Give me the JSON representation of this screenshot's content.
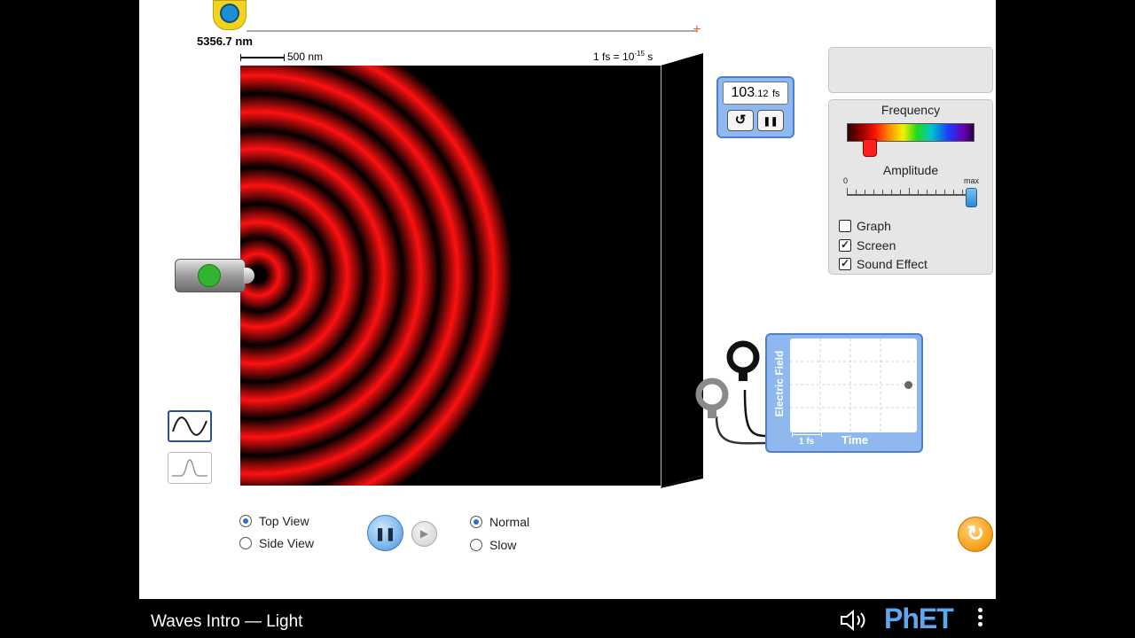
{
  "tape_measure": {
    "readout": "5356.7 nm"
  },
  "scale": {
    "length_label": "500 nm",
    "time_scale_prefix": "1 fs = 10",
    "time_scale_exponent": "-15",
    "time_scale_suffix": " s"
  },
  "stopwatch": {
    "value": "103",
    "decimals": ".12",
    "unit": "fs",
    "reset_icon": "↺",
    "pause_icon": "❚❚"
  },
  "controls": {
    "frequency_label": "Frequency",
    "frequency_value": 0.18,
    "amplitude_label": "Amplitude",
    "amplitude_min": "0",
    "amplitude_max": "max",
    "amplitude_value": 1.0,
    "checkboxes": [
      {
        "label": "Graph",
        "checked": false
      },
      {
        "label": "Screen",
        "checked": true
      },
      {
        "label": "Sound Effect",
        "checked": true
      }
    ]
  },
  "sensor": {
    "y_axis_label": "Electric Field",
    "x_axis_label": "Time",
    "scale_label": "1 fs"
  },
  "view_options": [
    {
      "label": "Top View",
      "selected": true
    },
    {
      "label": "Side View",
      "selected": false
    }
  ],
  "speed_options": [
    {
      "label": "Normal",
      "selected": true
    },
    {
      "label": "Slow",
      "selected": false
    }
  ],
  "playback": {
    "pause_icon": "❚❚",
    "step_icon": "▶"
  },
  "nav": {
    "title": "Waves Intro — Light",
    "logo": "PhET"
  },
  "colors": {
    "wave": "#ff1010",
    "accent": "#4d7fd0",
    "panel": "#e6e6e6",
    "reset_all": "#f7a21b"
  }
}
